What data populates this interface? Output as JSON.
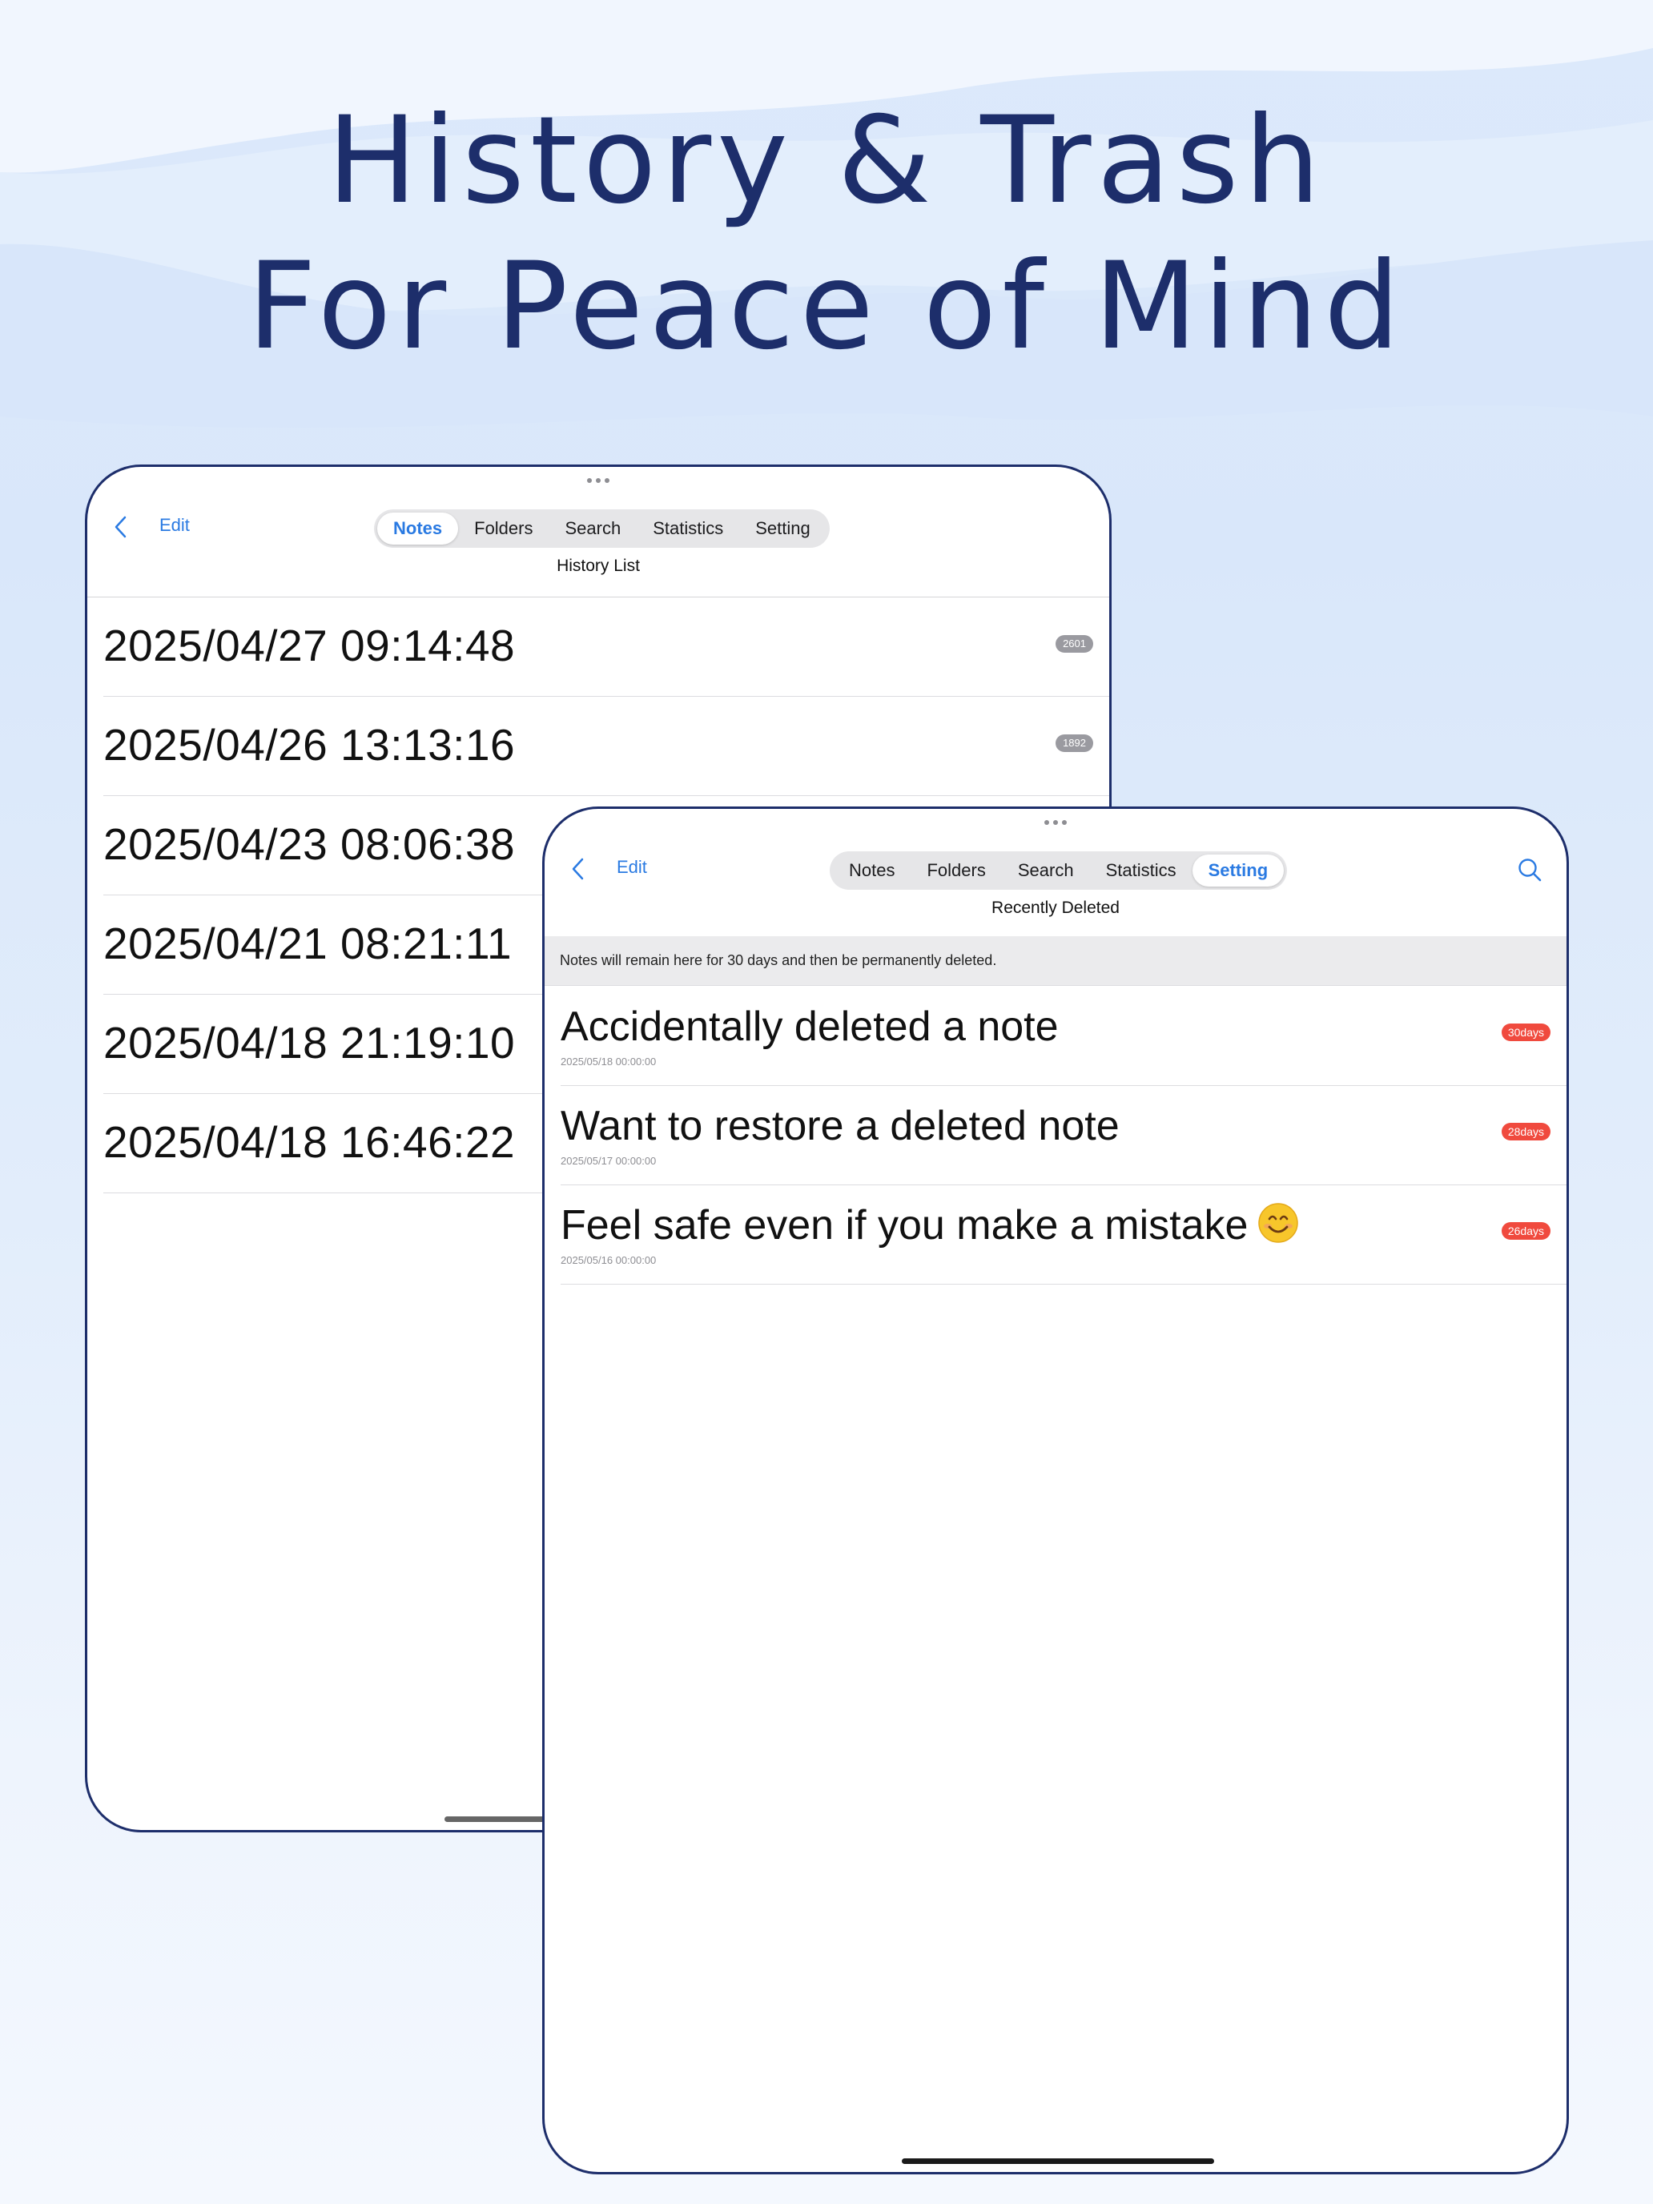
{
  "headline": {
    "line1": "History & Trash",
    "line2": "For Peace of Mind"
  },
  "colors": {
    "headline": "#1d2e6b",
    "accent": "#2a7ae2",
    "days_badge": "#f04a3e",
    "count_badge": "#9a9aa0"
  },
  "history_screen": {
    "edit_label": "Edit",
    "tabs": [
      {
        "label": "Notes",
        "active": true
      },
      {
        "label": "Folders",
        "active": false
      },
      {
        "label": "Search",
        "active": false
      },
      {
        "label": "Statistics",
        "active": false
      },
      {
        "label": "Setting",
        "active": false
      }
    ],
    "title": "History List",
    "rows": [
      {
        "time": "2025/04/27 09:14:48",
        "count": "2601"
      },
      {
        "time": "2025/04/26 13:13:16",
        "count": "1892"
      },
      {
        "time": "2025/04/23 08:06:38",
        "count": ""
      },
      {
        "time": "2025/04/21 08:21:11",
        "count": ""
      },
      {
        "time": "2025/04/18 21:19:10",
        "count": ""
      },
      {
        "time": "2025/04/18 16:46:22",
        "count": ""
      }
    ]
  },
  "trash_screen": {
    "edit_label": "Edit",
    "tabs": [
      {
        "label": "Notes",
        "active": false
      },
      {
        "label": "Folders",
        "active": false
      },
      {
        "label": "Search",
        "active": false
      },
      {
        "label": "Statistics",
        "active": false
      },
      {
        "label": "Setting",
        "active": true
      }
    ],
    "title": "Recently Deleted",
    "info": "Notes will remain here for 30 days and then be permanently deleted.",
    "rows": [
      {
        "title": "Accidentally deleted a note",
        "date": "2025/05/18 00:00:00",
        "days": "30days"
      },
      {
        "title": "Want to restore a deleted note",
        "date": "2025/05/17 00:00:00",
        "days": "28days"
      },
      {
        "title": "Feel safe even if you make a mistake",
        "date": "2025/05/16 00:00:00",
        "days": "26days",
        "emoji": "smiling-face-icon"
      }
    ]
  }
}
